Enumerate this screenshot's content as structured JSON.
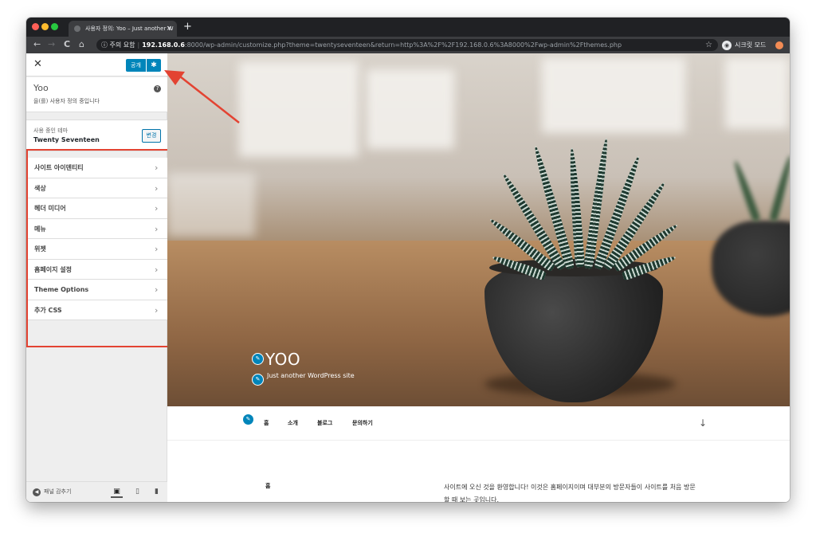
{
  "browser": {
    "tab_title": "사용자 정의: Yoo – Just another W",
    "tab_close": "×",
    "new_tab": "+",
    "nav": {
      "back": "←",
      "forward": "→",
      "reload": "C",
      "home": "⌂"
    },
    "url_security": "ⓘ 주의 요함",
    "url_host": "192.168.0.6",
    "url_rest": ":8000/wp-admin/customize.php?theme=twentyseventeen&return=http%3A%2F%2F192.168.0.6%3A8000%2Fwp-admin%2Fthemes.php",
    "bookmark_star": "☆",
    "incognito_label": "시크릿 모드"
  },
  "sidebar": {
    "close": "✕",
    "publish_label": "공개",
    "publish_settings": "✱",
    "site_title": "Yoo",
    "help": "?",
    "customizing_msg": "을(를) 사용자 정의 중입니다",
    "theme_label": "사용 중인 테마",
    "theme_name": "Twenty Seventeen",
    "change_label": "변경",
    "menu_items": [
      {
        "label": "사이트 아이덴티티"
      },
      {
        "label": "색상"
      },
      {
        "label": "헤더 미디어"
      },
      {
        "label": "메뉴"
      },
      {
        "label": "위젯"
      },
      {
        "label": "홈페이지 설정"
      },
      {
        "label": "Theme Options"
      },
      {
        "label": "추가 CSS"
      }
    ],
    "chevron": "›",
    "collapse_label": "패널 감추기"
  },
  "preview": {
    "site_title": "YOO",
    "tagline": "Just another WordPress site",
    "nav_items": [
      "홈",
      "소개",
      "블로그",
      "문의하기"
    ],
    "scroll_arrow": "↓",
    "content_heading": "홈",
    "content_text": "사이트에 오신 것을 환영합니다! 이것은 홈페이지이며 대부분의 방문자들이 사이트를 처음 방문할 때 보는 곳입니다."
  },
  "colors": {
    "primary_button": "#0085ba",
    "annotation_red": "#e34332",
    "browser_chrome": "#3c3d40"
  }
}
